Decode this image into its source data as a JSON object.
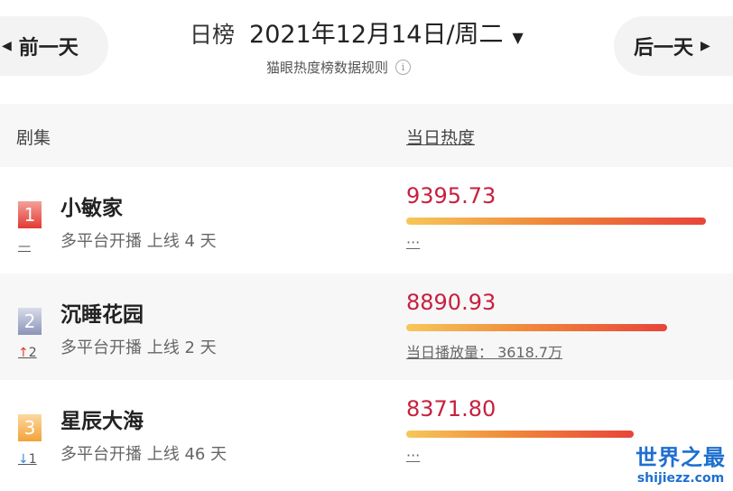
{
  "header": {
    "prev_day": "前一天",
    "next_day": "后一天",
    "board_label": "日榜",
    "date": "2021年12月14日/周二",
    "rule_text": "猫眼热度榜数据规则"
  },
  "table": {
    "col_series": "剧集",
    "col_heat": "当日热度"
  },
  "rows": [
    {
      "rank": "1",
      "change": "—",
      "change_dir": "none",
      "title": "小敏家",
      "subtitle": "多平台开播 上线 4 天",
      "score": "9395.73",
      "bar_fraction": 1.0,
      "extra": "···"
    },
    {
      "rank": "2",
      "change": "2",
      "change_dir": "up",
      "title": "沉睡花园",
      "subtitle": "多平台开播 上线 2 天",
      "score": "8890.93",
      "bar_fraction": 0.87,
      "extra": "当日播放量： 3618.7万"
    },
    {
      "rank": "3",
      "change": "1",
      "change_dir": "down",
      "title": "星辰大海",
      "subtitle": "多平台开播 上线 46 天",
      "score": "8371.80",
      "bar_fraction": 0.76,
      "extra": "···"
    }
  ],
  "watermark": {
    "cn": "世界之最",
    "en": "shijiezz.com"
  },
  "colors": {
    "score": "#c7203f",
    "bar_start": "#f6c75a",
    "bar_end": "#e8443a"
  }
}
